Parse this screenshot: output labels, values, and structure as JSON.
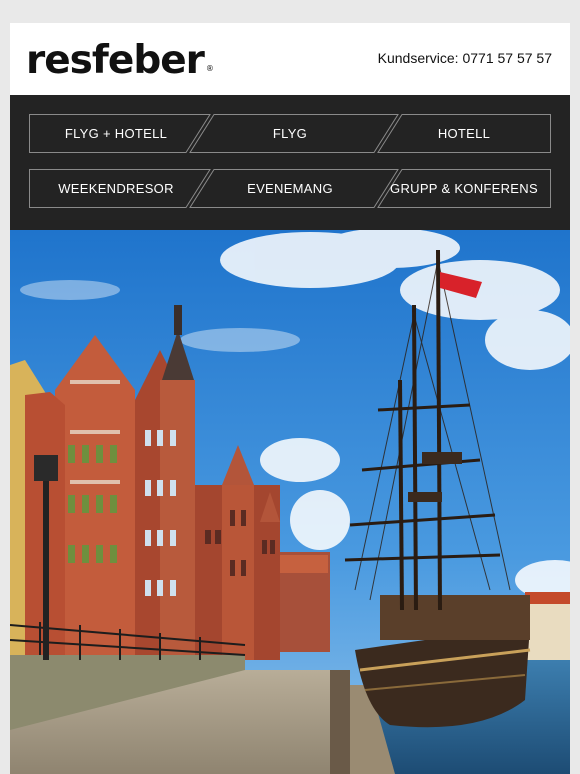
{
  "brand": {
    "logo_text": "resfeber",
    "registered_mark": "®"
  },
  "header": {
    "customer_service": "Kundservice: 0771 57 57 57"
  },
  "nav": {
    "row1": [
      {
        "label": "FLYG + HOTELL"
      },
      {
        "label": "FLYG"
      },
      {
        "label": "HOTELL"
      }
    ],
    "row2": [
      {
        "label": "WEEKENDRESOR"
      },
      {
        "label": "EVENEMANG"
      },
      {
        "label": "GRUPP & KONFERENS"
      }
    ]
  },
  "colors": {
    "page_bg": "#e9e9e9",
    "nav_bg": "#232323",
    "nav_border": "#8a8a8a",
    "sky": "#2f86d6",
    "brick": "#a4462f",
    "flag": "#d8222a"
  },
  "hero": {
    "icon": "harbor-photo"
  }
}
